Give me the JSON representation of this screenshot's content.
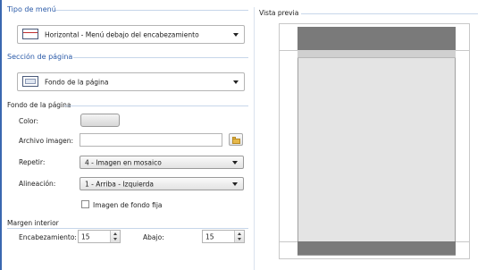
{
  "menu_type": {
    "heading": "Tipo de menú",
    "selected": "Horizontal - Menú debajo del encabezamiento"
  },
  "page_section": {
    "heading": "Sección de página",
    "selected": "Fondo de la página"
  },
  "page_background": {
    "heading": "Fondo de la página",
    "color_label": "Color:",
    "image_file_label": "Archivo imagen:",
    "image_file_value": "",
    "repeat_label": "Repetir:",
    "repeat_value": "4 - Imagen en mosaico",
    "alignment_label": "Alineación:",
    "alignment_value": "1 - Arriba - Izquierda",
    "fixed_bg_label": "Imagen de fondo fija",
    "fixed_bg_checked": false
  },
  "inner_margin": {
    "heading": "Margen interior",
    "header_label": "Encabezamiento:",
    "header_value": "15",
    "bottom_label": "Abajo:",
    "bottom_value": "15"
  },
  "preview": {
    "heading": "Vista previa"
  },
  "colors": {
    "section_heading": "#2a5aa8",
    "preview_header": "#7a7a7a",
    "preview_body": "#e4e4e4"
  }
}
